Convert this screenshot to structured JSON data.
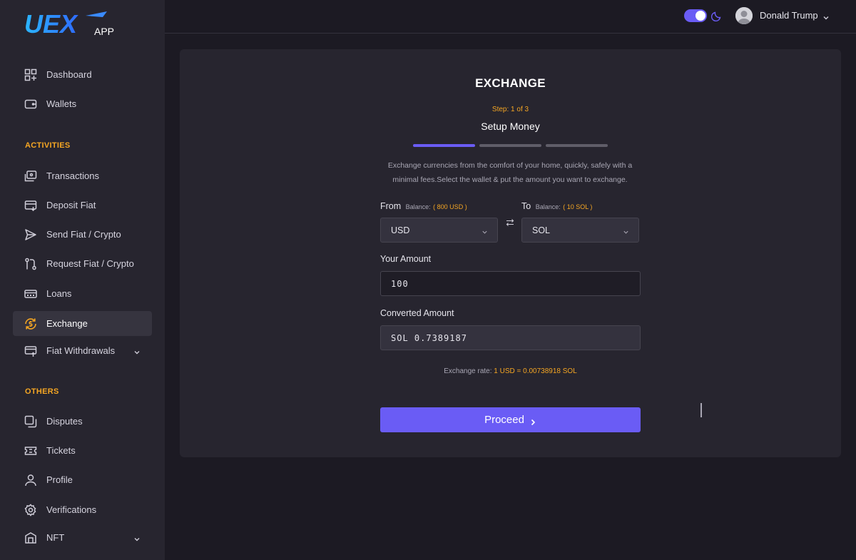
{
  "brand": {
    "logo_text": "UEX",
    "logo_sub": "APP",
    "accent": "#6a5cf5",
    "highlight": "#f5a623"
  },
  "sidebar": {
    "top_items": [
      {
        "label": "Dashboard",
        "icon": "dashboard-icon"
      },
      {
        "label": "Wallets",
        "icon": "wallet-icon"
      }
    ],
    "activities_title": "ACTIVITIES",
    "activities": [
      {
        "label": "Transactions",
        "icon": "transactions-icon"
      },
      {
        "label": "Deposit Fiat",
        "icon": "deposit-icon"
      },
      {
        "label": "Send Fiat / Crypto",
        "icon": "send-icon"
      },
      {
        "label": "Request Fiat / Crypto",
        "icon": "request-icon"
      },
      {
        "label": "Loans",
        "icon": "loans-icon"
      },
      {
        "label": "Exchange",
        "icon": "exchange-icon",
        "active": true
      },
      {
        "label": "Fiat Withdrawals",
        "icon": "withdraw-icon",
        "expandable": true
      }
    ],
    "others_title": "OTHERS",
    "others": [
      {
        "label": "Disputes",
        "icon": "disputes-icon"
      },
      {
        "label": "Tickets",
        "icon": "ticket-icon"
      },
      {
        "label": "Profile",
        "icon": "profile-icon"
      },
      {
        "label": "Verifications",
        "icon": "gear-icon"
      },
      {
        "label": "NFT",
        "icon": "nft-icon",
        "expandable": true
      }
    ]
  },
  "header": {
    "theme": "dark",
    "user_name": "Donald Trump"
  },
  "exchange": {
    "title": "EXCHANGE",
    "step": "Step: 1 of 3",
    "subtitle": "Setup Money",
    "progress_steps": 3,
    "current_step": 1,
    "description": "Exchange currencies from the comfort of your home, quickly, safely with a minimal fees.Select the wallet & put the amount you want to exchange.",
    "from": {
      "label": "From",
      "balance_label": "Balance:",
      "balance_value": "( 800 USD )",
      "selected": "USD"
    },
    "to": {
      "label": "To",
      "balance_label": "Balance:",
      "balance_value": "( 10 SOL )",
      "selected": "SOL"
    },
    "amount_label": "Your Amount",
    "amount_value": "100",
    "converted_label": "Converted Amount",
    "converted_value": "SOL 0.7389187",
    "rate_prefix": "Exchange rate: ",
    "rate_from": "1 USD",
    "rate_eq": " = ",
    "rate_to": "0.00738918 SOL",
    "proceed_label": "Proceed"
  }
}
